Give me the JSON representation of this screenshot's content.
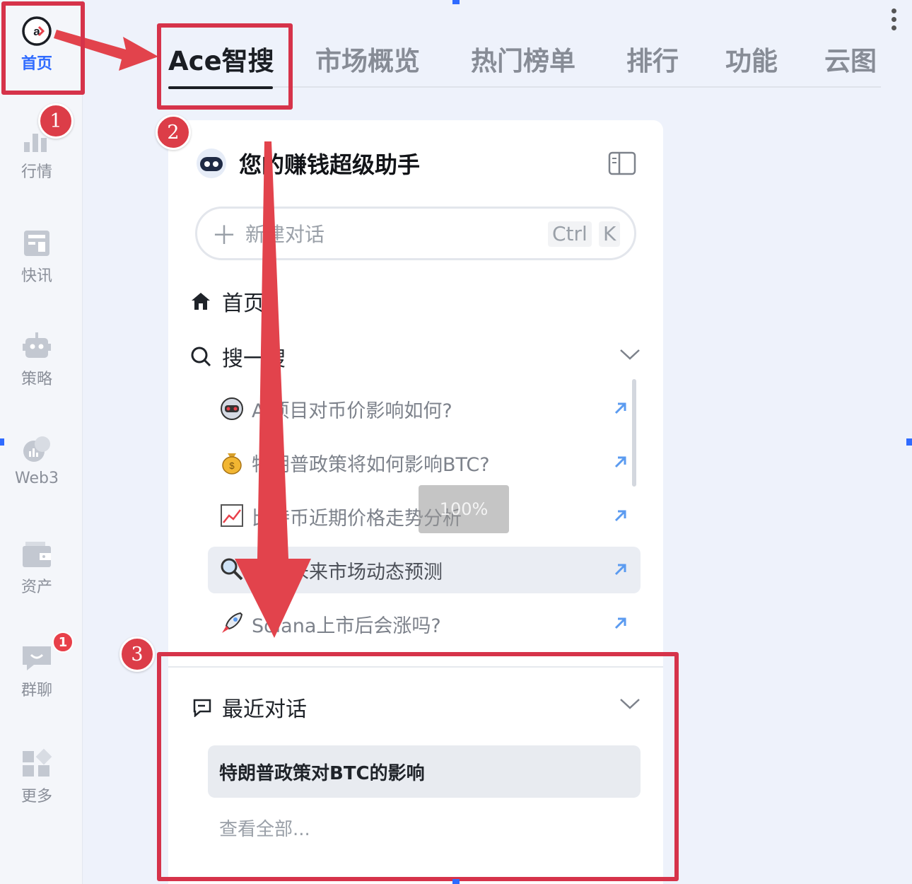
{
  "nav": {
    "items": [
      {
        "label": "首页",
        "icon": "ace-logo-icon",
        "active": true
      },
      {
        "label": "行情",
        "icon": "bar-chart-icon",
        "badge": "1"
      },
      {
        "label": "快讯",
        "icon": "news-icon"
      },
      {
        "label": "策略",
        "icon": "robot-icon"
      },
      {
        "label": "Web3",
        "icon": "web3-icon"
      },
      {
        "label": "资产",
        "icon": "wallet-icon"
      },
      {
        "label": "群聊",
        "icon": "chat-icon",
        "badge": "1"
      },
      {
        "label": "更多",
        "icon": "grid-icon"
      }
    ]
  },
  "tabs": [
    {
      "label": "Ace智搜",
      "active": true
    },
    {
      "label": "市场概览"
    },
    {
      "label": "热门榜单"
    },
    {
      "label": "排行"
    },
    {
      "label": "功能"
    },
    {
      "label": "云图"
    }
  ],
  "panel": {
    "title": "您的赚钱超级助手",
    "new_chat": {
      "label": "新建对话",
      "shortcut_ctrl": "Ctrl",
      "shortcut_key": "K"
    },
    "home_label": "首页",
    "search_label": "搜一搜",
    "suggestions": [
      {
        "text": "AI项目对币价影响如何?",
        "icon": "robot-face-icon"
      },
      {
        "text": "特朗普政策将如何影响BTC?",
        "icon": "money-bag-icon"
      },
      {
        "text": "比特币近期价格走势分析",
        "icon": "trend-chart-icon"
      },
      {
        "text": "分析未来市场动态预测",
        "icon": "magnifier-icon",
        "highlighted": true
      },
      {
        "text": "Solana上市后会涨吗?",
        "icon": "rocket-icon"
      }
    ],
    "recent_label": "最近对话",
    "recent_items": [
      {
        "text": "特朗普政策对BTC的影响"
      }
    ],
    "view_all": "查看全部..."
  },
  "overlay": {
    "zoom": "100%"
  },
  "annotations": {
    "step1": "1",
    "step2": "2",
    "step3": "3"
  },
  "colors": {
    "accent": "#2f6bff",
    "annotation_red": "#d6334a",
    "badge_red": "#e8404a"
  }
}
